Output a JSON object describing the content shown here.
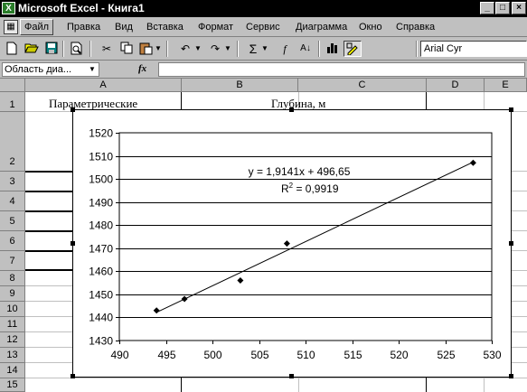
{
  "window": {
    "title": "Microsoft Excel - Книга1",
    "icon": "excel-app-icon"
  },
  "menu": {
    "items": [
      "Файл",
      "Правка",
      "Вид",
      "Вставка",
      "Формат",
      "Сервис",
      "Диаграмма",
      "Окно",
      "Справка"
    ],
    "active_index": 0
  },
  "toolbar": {
    "buttons": [
      "new-icon",
      "open-icon",
      "save-icon",
      "print-preview-icon",
      "cut-icon",
      "copy-icon",
      "paste-icon",
      "undo-icon",
      "redo-icon",
      "autosum-icon",
      "function-wizard-icon",
      "sort-icon",
      "chart-icon",
      "drawing-icon"
    ],
    "font_name": "Arial Cyr"
  },
  "formula_bar": {
    "name_box": "Область диа...",
    "fx_label": "fx",
    "content": ""
  },
  "sheet": {
    "columns": [
      "A",
      "B",
      "C",
      "D",
      "E"
    ],
    "rows": [
      "1",
      "2",
      "3",
      "4",
      "5",
      "6",
      "7",
      "8",
      "9",
      "10",
      "11",
      "12",
      "13",
      "14",
      "15"
    ],
    "cells": {
      "A1": "Параметрические",
      "B1": "Глубина, м"
    }
  },
  "chart_data": {
    "type": "scatter",
    "title": "",
    "xlabel": "",
    "ylabel": "",
    "xlim": [
      490,
      530
    ],
    "ylim": [
      1430,
      1520
    ],
    "x_ticks": [
      490,
      495,
      500,
      505,
      510,
      515,
      520,
      525,
      530
    ],
    "y_ticks": [
      1430,
      1440,
      1450,
      1460,
      1470,
      1480,
      1490,
      1500,
      1510,
      1520
    ],
    "grid": "horizontal",
    "series": [
      {
        "points": [
          [
            494,
            1443
          ],
          [
            497,
            1448
          ],
          [
            503,
            1456
          ],
          [
            508,
            1472
          ],
          [
            528,
            1507
          ]
        ]
      }
    ],
    "trendline": {
      "slope": 1.9141,
      "intercept": 496.65,
      "equation": "y = 1,9141x + 496,65",
      "r2_label": "R",
      "r2_value": " = 0,9919"
    }
  }
}
